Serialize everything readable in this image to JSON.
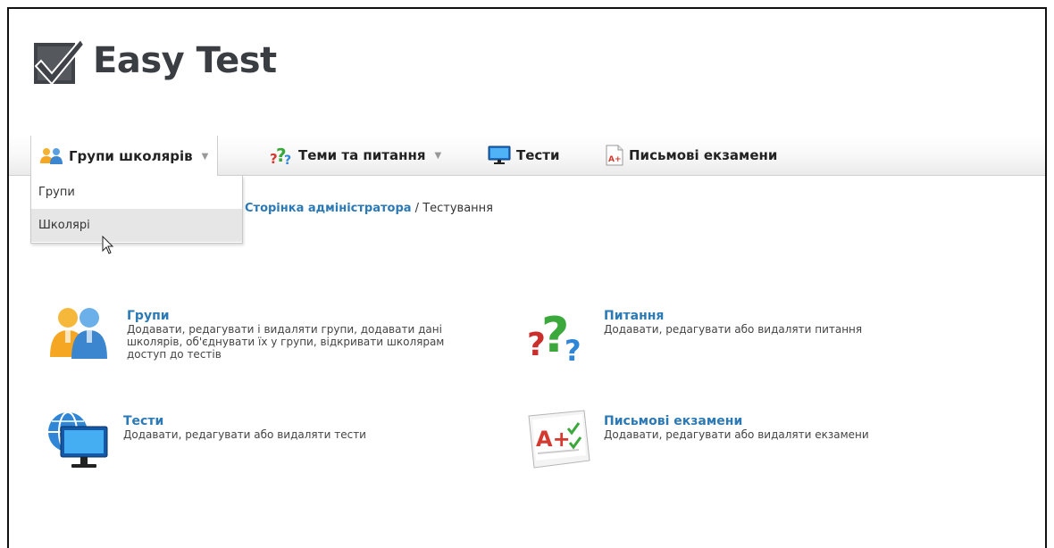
{
  "app": {
    "logo_text": "Easy Test"
  },
  "nav": {
    "items": [
      {
        "label": "Групи школярів",
        "icon": "people-icon",
        "has_caret": true
      },
      {
        "label": "Теми та питання",
        "icon": "question-icon",
        "has_caret": true
      },
      {
        "label": "Тести",
        "icon": "monitor-icon",
        "has_caret": false
      },
      {
        "label": "Письмові екзамени",
        "icon": "exam-paper-icon",
        "has_caret": false
      }
    ],
    "caret": "▼"
  },
  "dropdown": {
    "items": [
      {
        "label": "Групи"
      },
      {
        "label": "Школярі"
      }
    ]
  },
  "breadcrumb": {
    "link": "Сторінка адміністратора",
    "separator": " / ",
    "current": "Тестування"
  },
  "tiles": [
    {
      "title": "Групи",
      "desc": "Додавати, редагувати і видаляти групи, додавати дані школярів, об'єднувати їх у групи, відкривати школярам доступ до тестів",
      "icon": "people-icon"
    },
    {
      "title": "Питання",
      "desc": "Додавати, редагувати або видаляти питання",
      "icon": "question-icon"
    },
    {
      "title": "Тести",
      "desc": "Додавати, редагувати або видаляти тести",
      "icon": "globe-monitor-icon"
    },
    {
      "title": "Письмові екзамени",
      "desc": "Додавати, редагувати або видаляти екзамени",
      "icon": "exam-paper-icon"
    }
  ],
  "colors": {
    "link": "#2b79b5",
    "logo_text": "#3a3d42",
    "dropdown_hover": "#e6e6e6"
  }
}
